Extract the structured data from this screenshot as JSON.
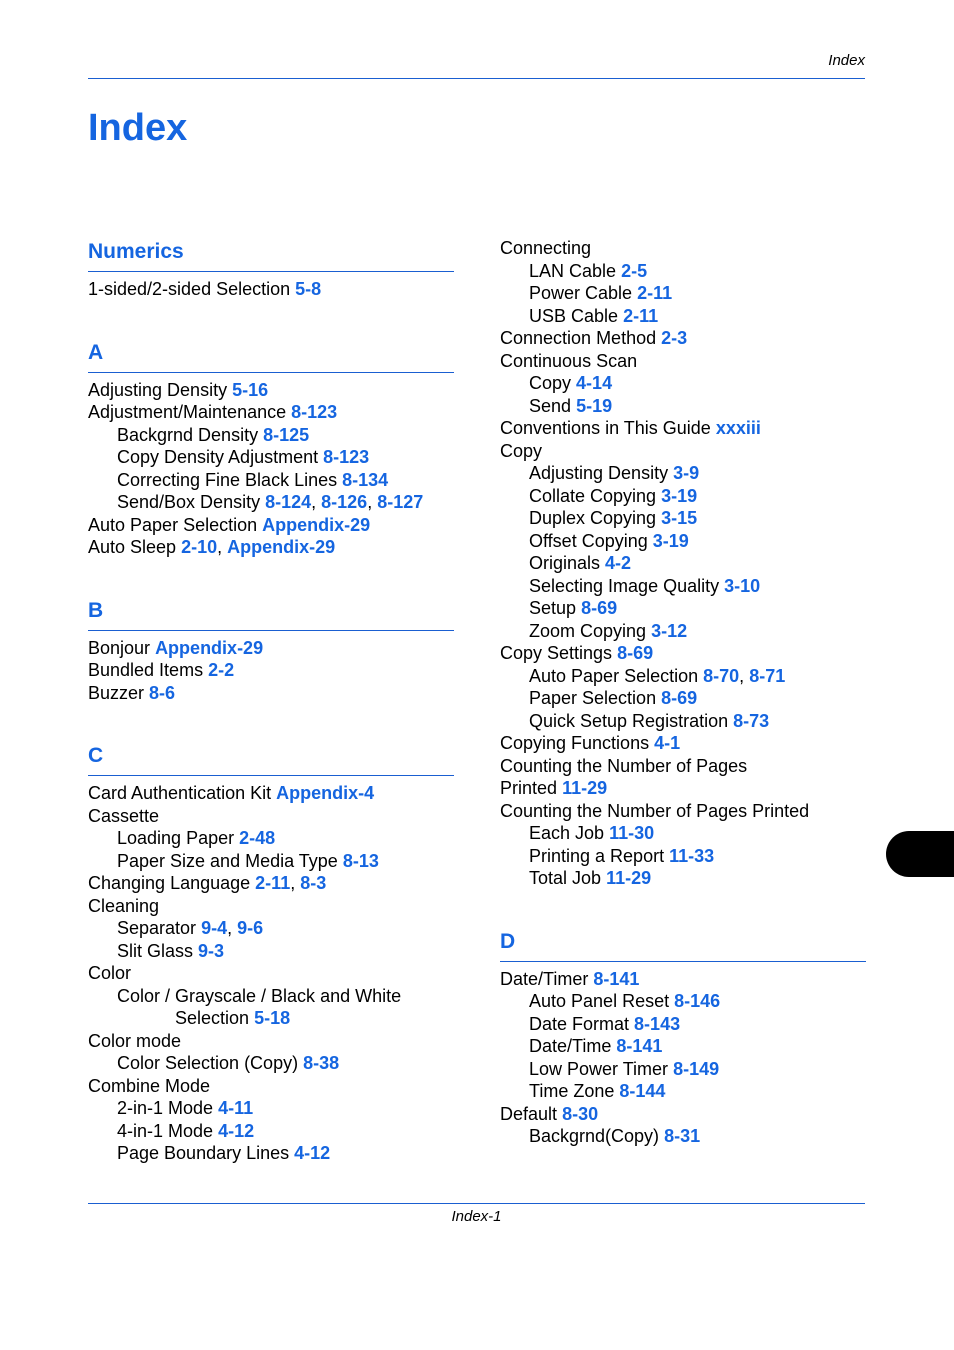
{
  "header": {
    "running_title": "Index"
  },
  "page_title": "Index",
  "footer": {
    "page_number": "Index-1"
  },
  "colors": {
    "accent": "#1565e0",
    "rule": "#1a5fd1",
    "text": "#000000"
  },
  "left_column": [
    {
      "heading": "Numerics",
      "entries": [
        {
          "level": 0,
          "text": "1-sided/2-sided Selection",
          "refs": [
            "5-8"
          ]
        }
      ]
    },
    {
      "heading": "A",
      "entries": [
        {
          "level": 0,
          "text": "Adjusting Density",
          "refs": [
            "5-16"
          ]
        },
        {
          "level": 0,
          "text": "Adjustment/Maintenance",
          "refs": [
            "8-123"
          ]
        },
        {
          "level": 1,
          "text": "Backgrnd Density",
          "refs": [
            "8-125"
          ]
        },
        {
          "level": 1,
          "text": "Copy Density Adjustment",
          "refs": [
            "8-123"
          ]
        },
        {
          "level": 1,
          "text": "Correcting Fine Black Lines",
          "refs": [
            "8-134"
          ]
        },
        {
          "level": 1,
          "text": "Send/Box Density",
          "refs": [
            "8-124",
            "8-126",
            "8-127"
          ]
        },
        {
          "level": 0,
          "text": "Auto Paper Selection",
          "refs": [
            "Appendix-29"
          ]
        },
        {
          "level": 0,
          "text": "Auto Sleep",
          "refs": [
            "2-10",
            "Appendix-29"
          ]
        }
      ]
    },
    {
      "heading": "B",
      "entries": [
        {
          "level": 0,
          "text": "Bonjour",
          "refs": [
            "Appendix-29"
          ]
        },
        {
          "level": 0,
          "text": "Bundled Items",
          "refs": [
            "2-2"
          ]
        },
        {
          "level": 0,
          "text": "Buzzer",
          "refs": [
            "8-6"
          ]
        }
      ]
    },
    {
      "heading": "C",
      "entries": [
        {
          "level": 0,
          "text": "Card Authentication Kit",
          "refs": [
            "Appendix-4"
          ]
        },
        {
          "level": 0,
          "text": "Cassette",
          "refs": []
        },
        {
          "level": 1,
          "text": "Loading Paper",
          "refs": [
            "2-48"
          ]
        },
        {
          "level": 1,
          "text": "Paper Size and Media Type",
          "refs": [
            "8-13"
          ]
        },
        {
          "level": 0,
          "text": "Changing Language",
          "refs": [
            "2-11",
            "8-3"
          ]
        },
        {
          "level": 0,
          "text": "Cleaning",
          "refs": []
        },
        {
          "level": 1,
          "text": "Separator",
          "refs": [
            "9-4",
            "9-6"
          ]
        },
        {
          "level": 1,
          "text": "Slit Glass",
          "refs": [
            "9-3"
          ]
        },
        {
          "level": 0,
          "text": "Color",
          "refs": []
        },
        {
          "level": 1,
          "text": "Color / Grayscale / Black and White",
          "refs": []
        },
        {
          "level": 2,
          "text": "Selection",
          "refs": [
            "5-18"
          ]
        },
        {
          "level": 0,
          "text": "Color mode",
          "refs": []
        },
        {
          "level": 1,
          "text": "Color Selection (Copy)",
          "refs": [
            "8-38"
          ]
        },
        {
          "level": 0,
          "text": "Combine Mode",
          "refs": []
        },
        {
          "level": 1,
          "text": "2-in-1 Mode",
          "refs": [
            "4-11"
          ]
        },
        {
          "level": 1,
          "text": "4-in-1 Mode",
          "refs": [
            "4-12"
          ]
        },
        {
          "level": 1,
          "text": "Page Boundary Lines",
          "refs": [
            "4-12"
          ]
        }
      ]
    }
  ],
  "right_column": [
    {
      "heading": null,
      "entries": [
        {
          "level": 0,
          "text": "Connecting",
          "refs": []
        },
        {
          "level": 1,
          "text": "LAN Cable",
          "refs": [
            "2-5"
          ]
        },
        {
          "level": 1,
          "text": "Power Cable",
          "refs": [
            "2-11"
          ]
        },
        {
          "level": 1,
          "text": "USB Cable",
          "refs": [
            "2-11"
          ]
        },
        {
          "level": 0,
          "text": "Connection Method",
          "refs": [
            "2-3"
          ]
        },
        {
          "level": 0,
          "text": "Continuous Scan",
          "refs": []
        },
        {
          "level": 1,
          "text": "Copy",
          "refs": [
            "4-14"
          ]
        },
        {
          "level": 1,
          "text": "Send",
          "refs": [
            "5-19"
          ]
        },
        {
          "level": 0,
          "text": "Conventions in This Guide",
          "refs": [
            "xxxiii"
          ]
        },
        {
          "level": 0,
          "text": "Copy",
          "refs": []
        },
        {
          "level": 1,
          "text": "Adjusting Density",
          "refs": [
            "3-9"
          ]
        },
        {
          "level": 1,
          "text": "Collate Copying",
          "refs": [
            "3-19"
          ]
        },
        {
          "level": 1,
          "text": "Duplex Copying",
          "refs": [
            "3-15"
          ]
        },
        {
          "level": 1,
          "text": "Offset Copying",
          "refs": [
            "3-19"
          ]
        },
        {
          "level": 1,
          "text": "Originals",
          "refs": [
            "4-2"
          ]
        },
        {
          "level": 1,
          "text": "Selecting Image Quality",
          "refs": [
            "3-10"
          ]
        },
        {
          "level": 1,
          "text": "Setup",
          "refs": [
            "8-69"
          ]
        },
        {
          "level": 1,
          "text": "Zoom Copying",
          "refs": [
            "3-12"
          ]
        },
        {
          "level": 0,
          "text": "Copy Settings",
          "refs": [
            "8-69"
          ]
        },
        {
          "level": 1,
          "text": "Auto Paper Selection",
          "refs": [
            "8-70",
            "8-71"
          ]
        },
        {
          "level": 1,
          "text": "Paper Selection",
          "refs": [
            "8-69"
          ]
        },
        {
          "level": 1,
          "text": "Quick Setup Registration",
          "refs": [
            "8-73"
          ]
        },
        {
          "level": 0,
          "text": "Copying Functions",
          "refs": [
            "4-1"
          ]
        },
        {
          "level": 0,
          "text": "Counting the Number of Pages",
          "refs": []
        },
        {
          "level": 0,
          "text": "Printed",
          "refs": [
            "11-29"
          ]
        },
        {
          "level": 0,
          "text": "Counting the Number of Pages Printed",
          "refs": []
        },
        {
          "level": 1,
          "text": "Each Job",
          "refs": [
            "11-30"
          ]
        },
        {
          "level": 1,
          "text": "Printing a Report",
          "refs": [
            "11-33"
          ]
        },
        {
          "level": 1,
          "text": "Total Job",
          "refs": [
            "11-29"
          ]
        }
      ]
    },
    {
      "heading": "D",
      "entries": [
        {
          "level": 0,
          "text": "Date/Timer",
          "refs": [
            "8-141"
          ]
        },
        {
          "level": 1,
          "text": "Auto Panel Reset",
          "refs": [
            "8-146"
          ]
        },
        {
          "level": 1,
          "text": "Date Format",
          "refs": [
            "8-143"
          ]
        },
        {
          "level": 1,
          "text": "Date/Time",
          "refs": [
            "8-141"
          ]
        },
        {
          "level": 1,
          "text": "Low Power Timer",
          "refs": [
            "8-149"
          ]
        },
        {
          "level": 1,
          "text": "Time Zone",
          "refs": [
            "8-144"
          ]
        },
        {
          "level": 0,
          "text": "Default",
          "refs": [
            "8-30"
          ]
        },
        {
          "level": 1,
          "text": "Backgrnd(Copy)",
          "refs": [
            "8-31"
          ]
        }
      ]
    }
  ]
}
